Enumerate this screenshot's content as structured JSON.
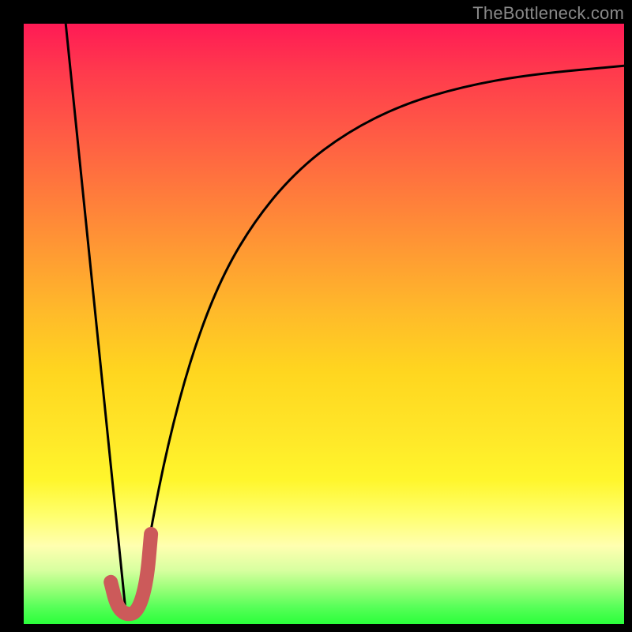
{
  "watermark": "TheBottleneck.com",
  "chart_data": {
    "type": "line",
    "title": "",
    "xlabel": "",
    "ylabel": "",
    "xlim": [
      0,
      100
    ],
    "ylim": [
      0,
      100
    ],
    "gradient_stops": [
      {
        "pct": 0,
        "color": "#ff1a55"
      },
      {
        "pct": 8,
        "color": "#ff3a4d"
      },
      {
        "pct": 18,
        "color": "#ff5a45"
      },
      {
        "pct": 28,
        "color": "#ff7a3c"
      },
      {
        "pct": 38,
        "color": "#ff9a33"
      },
      {
        "pct": 48,
        "color": "#ffba2a"
      },
      {
        "pct": 58,
        "color": "#ffd61f"
      },
      {
        "pct": 68,
        "color": "#ffe628"
      },
      {
        "pct": 76,
        "color": "#fff62c"
      },
      {
        "pct": 82,
        "color": "#ffff6e"
      },
      {
        "pct": 87,
        "color": "#ffffb0"
      },
      {
        "pct": 91,
        "color": "#d8ffa0"
      },
      {
        "pct": 94,
        "color": "#9cff7a"
      },
      {
        "pct": 97,
        "color": "#5aff5a"
      },
      {
        "pct": 100,
        "color": "#2aff3a"
      }
    ],
    "series": [
      {
        "name": "left-falling-line",
        "color": "#000000",
        "stroke_width": 3,
        "x": [
          7,
          17
        ],
        "y": [
          100,
          2
        ]
      },
      {
        "name": "right-rising-curve",
        "color": "#000000",
        "stroke_width": 3,
        "x": [
          19,
          21,
          24,
          28,
          33,
          39,
          46,
          54,
          63,
          73,
          84,
          100
        ],
        "y": [
          2,
          15,
          30,
          45,
          58,
          68,
          76,
          82,
          86.5,
          89.5,
          91.5,
          93
        ]
      },
      {
        "name": "j-marker",
        "color": "#cc5a5a",
        "stroke_width": 18,
        "x": [
          14.5,
          15.5,
          17,
          19,
          20.5,
          21.2
        ],
        "y": [
          7,
          3,
          1.5,
          2,
          7,
          15
        ]
      }
    ]
  }
}
